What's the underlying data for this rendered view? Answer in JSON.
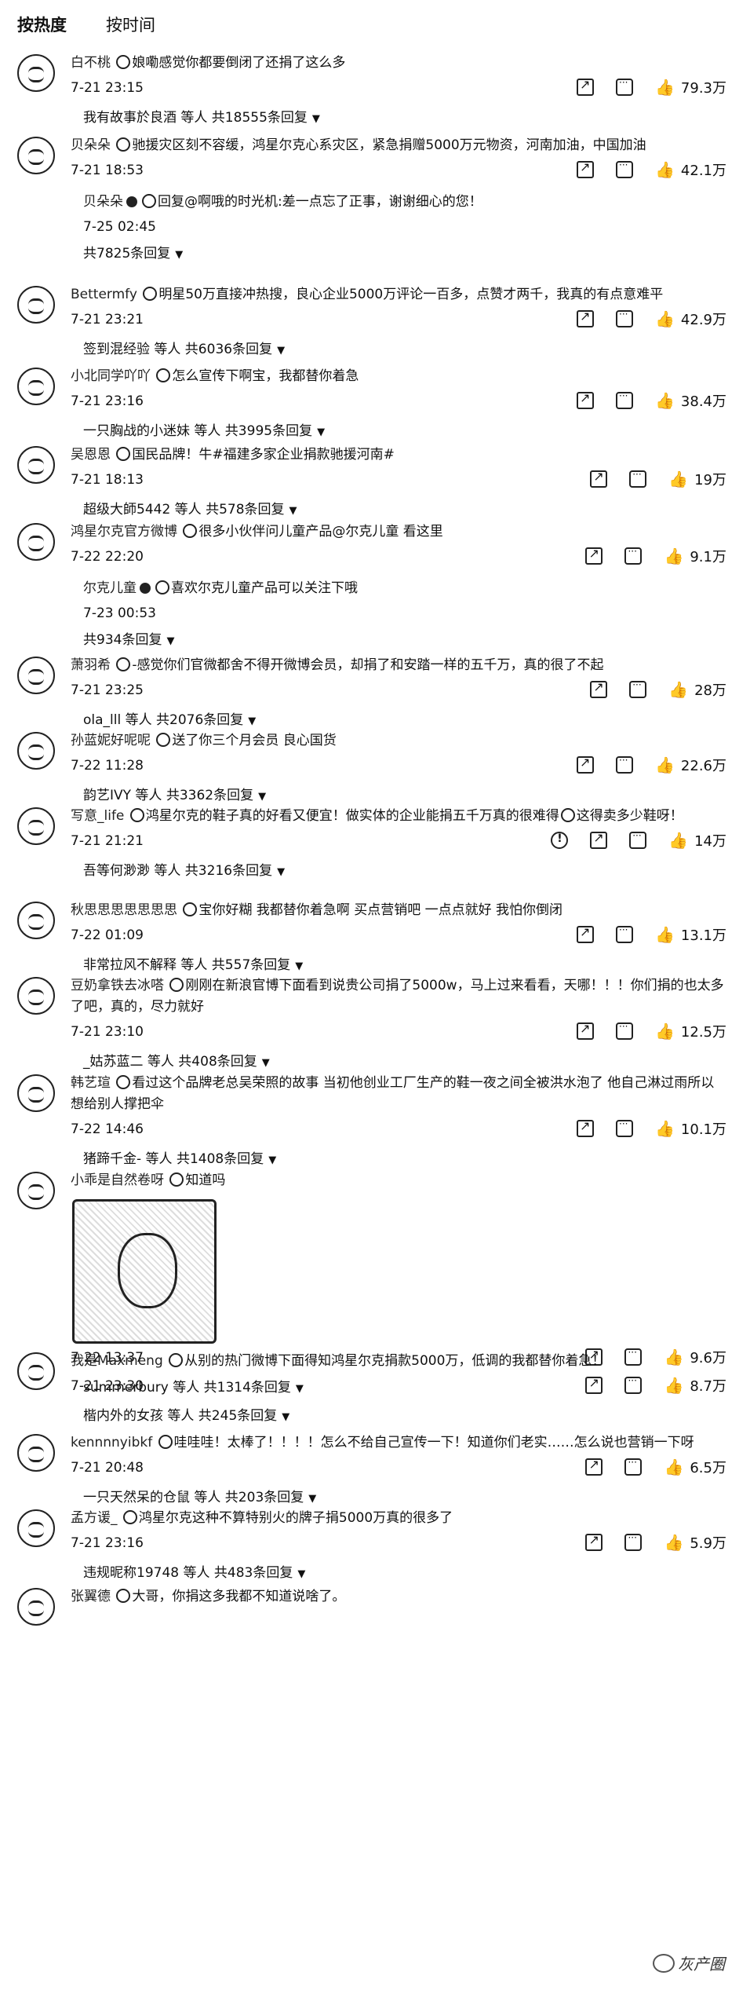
{
  "tabs": [
    {
      "label": "按热度",
      "active": true
    },
    {
      "label": "按时间",
      "active": false
    }
  ],
  "comments": [
    {
      "user": "白不桃",
      "text": "娘嘞感觉你都要倒闭了还捐了这么多",
      "time": "7-21 23:15",
      "likes": "79.3万",
      "sub": "我有故事於良酒 等人 共18555条回复",
      "actions": [
        "share",
        "comment"
      ]
    },
    {
      "user": "贝朵朵",
      "text": "驰援灾区刻不容缓，鸿星尔克心系灾区，紧急捐赠5000万元物资，河南加油，中国加油",
      "time": "7-21 18:53",
      "likes": "42.1万",
      "actions": [
        "share",
        "comment"
      ],
      "reply": {
        "user": "贝朵朵",
        "text": "回复@啊哦的时光机:差一点忘了正事，谢谢细心的您！",
        "time": "7-25 02:45"
      },
      "sub": "共7825条回复"
    },
    {
      "user": "Bettermfy",
      "text": "明星50万直接冲热搜，良心企业5000万评论一百多，点赞才两千，我真的有点意难平",
      "time": "7-21 23:21",
      "likes": "42.9万",
      "sub": "签到混经验 等人 共6036条回复",
      "actions": [
        "share",
        "comment"
      ]
    },
    {
      "user": "小北同学吖吖",
      "text": "怎么宣传下啊宝，我都替你着急",
      "time": "7-21 23:16",
      "likes": "38.4万",
      "sub": "一只胸战的小迷妹 等人 共3995条回复",
      "actions": [
        "share",
        "comment"
      ]
    },
    {
      "user": "吴恩恩",
      "text": "国民品牌！牛#福建多家企业捐款驰援河南#",
      "time": "7-21 18:13",
      "likes": "19万",
      "sub": "超级大師5442 等人 共578条回复",
      "actions": [
        "share",
        "comment"
      ]
    },
    {
      "user": "鸿星尔克官方微博",
      "text": "很多小伙伴问儿童产品@尔克儿童 看这里",
      "time": "7-22 22:20",
      "likes": "9.1万",
      "actions": [
        "share",
        "comment"
      ],
      "reply": {
        "user": "尔克儿童",
        "text": "喜欢尔克儿童产品可以关注下哦",
        "time": "7-23 00:53"
      },
      "sub": "共934条回复"
    },
    {
      "user": "萧羽希",
      "text": "-感觉你们官微都舍不得开微博会员，却捐了和安踏一样的五千万，真的很了不起",
      "time": "7-21 23:25",
      "likes": "28万",
      "sub": "ola_lll 等人 共2076条回复",
      "actions": [
        "share",
        "comment"
      ]
    },
    {
      "user": "孙蓝妮好呢呢",
      "text": "送了你三个月会员 良心国货",
      "time": "7-22 11:28",
      "likes": "22.6万",
      "sub": "韵艺IVY 等人 共3362条回复",
      "actions": [
        "share",
        "comment"
      ]
    },
    {
      "user": "写意_life",
      "text": "鸿星尔克的鞋子真的好看又便宜！做实体的企业能捐五千万真的很难得",
      "text2": "这得卖多少鞋呀！",
      "time": "7-21 21:21",
      "likes": "14万",
      "sub": "吾等何渺渺 等人 共3216条回复",
      "actions": [
        "warn",
        "share",
        "comment"
      ]
    },
    {
      "user": "秋思思思思思思思",
      "text": "宝你好糊 我都替你着急啊 买点营销吧 一点点就好 我怕你倒闭",
      "time": "7-22 01:09",
      "likes": "13.1万",
      "sub": "非常拉风不解释 等人 共557条回复",
      "actions": [
        "share",
        "comment"
      ]
    },
    {
      "user": "豆奶拿铁去冰嗒",
      "text": "刚刚在新浪官博下面看到说贵公司捐了5000w，马上过来看看，天哪！！！你们捐的也太多了吧，真的，尽力就好",
      "time": "7-21 23:10",
      "likes": "12.5万",
      "sub": "_姑苏蓝二 等人 共408条回复",
      "actions": [
        "share",
        "comment"
      ]
    },
    {
      "user": "韩艺瑄",
      "text": "看过这个品牌老总吴荣照的故事 当初他创业工厂生产的鞋一夜之间全被洪水泡了 他自己淋过雨所以想给别人撑把伞",
      "time": "7-22 14:46",
      "likes": "10.1万",
      "sub": "猪蹄千金- 等人 共1408条回复",
      "actions": [
        "share",
        "comment"
      ]
    },
    {
      "user": "小乖是自然卷呀",
      "text": "知道吗",
      "time": "7-22 13:37",
      "likes": "9.6万",
      "sub": "summerbury 等人 共1314条回复",
      "actions": [
        "share",
        "comment"
      ],
      "has_pic": true
    },
    {
      "user": "我是Maxmeng",
      "text": "从别的热门微博下面得知鸿星尔克捐款5000万，低调的我都替你着急！",
      "time": "7-21 23:30",
      "likes": "8.7万",
      "sub": "楷内外的女孩 等人 共245条回复",
      "actions": [
        "share",
        "comment"
      ]
    },
    {
      "user": "kennnnyibkf",
      "text": "哇哇哇！太棒了！！！！怎么不给自己宣传一下！知道你们老实……怎么说也营销一下呀",
      "time": "7-21 20:48",
      "likes": "6.5万",
      "sub": "一只天然呆的仓鼠 等人 共203条回复",
      "actions": [
        "share",
        "comment"
      ]
    },
    {
      "user": "孟方谖_",
      "text": "鸿星尔克这种不算特别火的牌子捐5000万真的很多了",
      "time": "7-21 23:16",
      "likes": "5.9万",
      "sub": "违规昵称19748 等人 共483条回复",
      "actions": [
        "share",
        "comment"
      ]
    },
    {
      "user": "张翼德",
      "text": "大哥，你捐这多我都不知道说啥了。",
      "time": "",
      "likes": "",
      "sub": "",
      "actions": []
    }
  ],
  "watermark": "灰产圈"
}
